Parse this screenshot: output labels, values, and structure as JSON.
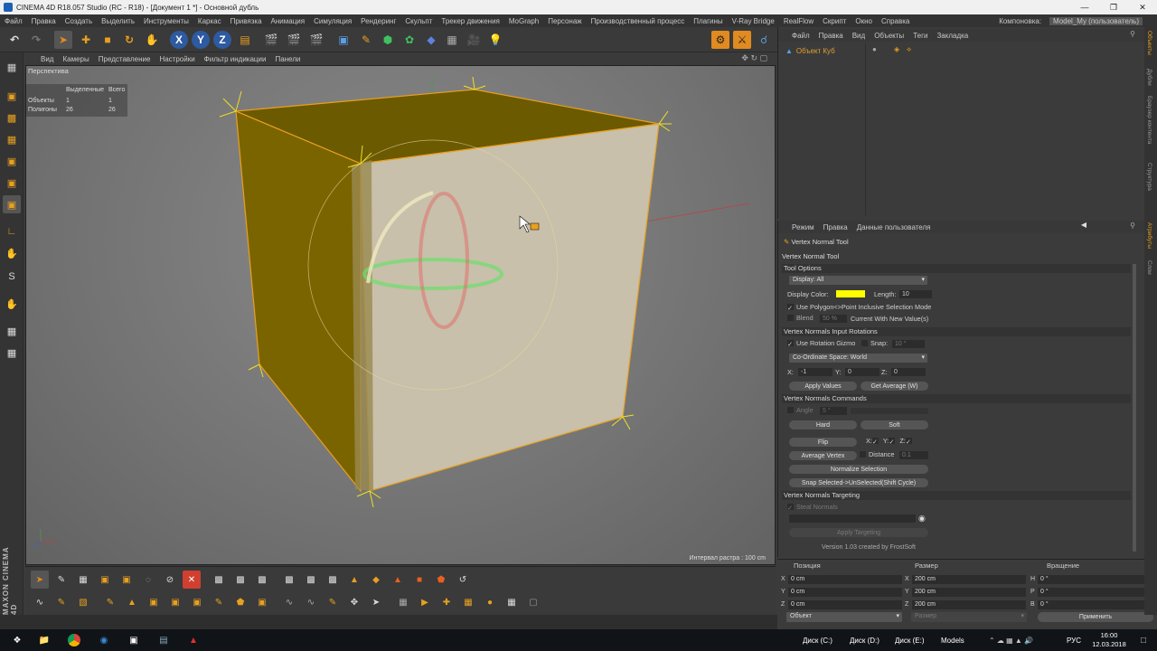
{
  "window": {
    "title": "CINEMA 4D R18.057 Studio (RC - R18) - [Документ 1 *] - Основной дубль"
  },
  "menu": [
    "Файл",
    "Правка",
    "Создать",
    "Выделить",
    "Инструменты",
    "Каркас",
    "Привязка",
    "Анимация",
    "Симуляция",
    "Рендеринг",
    "Скульпт",
    "Трекер движения",
    "MoGraph",
    "Персонаж",
    "Производственный процесс",
    "Плагины",
    "V-Ray Bridge",
    "RealFlow",
    "Скрипт",
    "Окно",
    "Справка"
  ],
  "layout": {
    "label": "Компоновка:",
    "value": "Model_My (пользователь)"
  },
  "viewport": {
    "menu": [
      "Вид",
      "Камеры",
      "Представление",
      "Настройки",
      "Фильтр индикации",
      "Панели"
    ],
    "label": "Перспектива",
    "hud": {
      "col_selected": "Выделенные",
      "col_total": "Всего",
      "row_objects": "Объекты",
      "row_polygons": "Полигоны",
      "objects_selected": "1",
      "objects_total": "1",
      "polygons_selected": "26",
      "polygons_total": "26"
    },
    "grid_note": "Интервал растра : 100 cm"
  },
  "object_manager": {
    "menu": [
      "Файл",
      "Правка",
      "Вид",
      "Объекты",
      "Теги",
      "Закладка"
    ],
    "object_name": "Объект Куб"
  },
  "attributes": {
    "menu": [
      "Режим",
      "Правка",
      "Данные пользователя"
    ],
    "header_title": "Vertex Normal Tool",
    "title": "Vertex Normal Tool",
    "tool_options": "Tool Options",
    "display_label": "Display: All",
    "display_color_label": "Display Color:",
    "display_color": "#ffff00",
    "length_label": "Length:",
    "length_value": "10",
    "use_polygon_point": "Use Polygon<>Point Inclusive Selection Mode",
    "blend_label": "Blend",
    "blend_value": "50 %",
    "current_with_new": "Current With New Value(s)",
    "input_rotations": "Vertex Normals Input Rotations",
    "use_rotation_gizmo": "Use Rotation Gizmo",
    "snap_label": "Snap:",
    "snap_value": "10 °",
    "coord_space": "Co-Ordinate Space: World",
    "x_label": "X:",
    "x_value": "-1",
    "y_label": "Y:",
    "y_value": "0",
    "z_label": "Z:",
    "z_value": "0",
    "apply_values": "Apply Values",
    "get_average": "Get Average (W)",
    "commands": "Vertex Normals Commands",
    "angle_label": "Angle",
    "angle_value": "5 °",
    "hard": "Hard",
    "soft": "Soft",
    "flip": "Flip",
    "flip_x": "X:",
    "flip_y": "Y:",
    "flip_z": "Z:",
    "average_vertex": "Average Vertex",
    "distance_label": "Distance",
    "distance_value": "0.1",
    "normalize_selection": "Normalize Selection",
    "snap_selected": "Snap Selected->UnSelected(Shift Cycle)",
    "targeting": "Vertex Normals Targeting",
    "steal_normals": "Steal Normals",
    "apply_targeting": "Apply Targeting",
    "version": "Version 1.03 created by FrostSoft"
  },
  "coords": {
    "position": "Позиция",
    "size": "Размер",
    "rotation": "Вращение",
    "px": "0 cm",
    "py": "0 cm",
    "pz": "0 cm",
    "sx": "200 cm",
    "sy": "200 cm",
    "sz": "200 cm",
    "rh": "0 °",
    "rp": "0 °",
    "rb": "0 °",
    "mode": "Объект",
    "size_mode": "Размер",
    "apply": "Применить",
    "lx": "X",
    "ly": "Y",
    "lz": "Z",
    "lsx": "X",
    "lsy": "Y",
    "lsz": "Z",
    "lh": "H",
    "lp": "P",
    "lb": "B"
  },
  "right_strip": [
    "Объекты",
    "Дубли",
    "Браузер контента",
    "Структура"
  ],
  "right_strip2": [
    "Атрибуты",
    "Слои"
  ],
  "taskbar": {
    "disk_c": "Диск (C:)",
    "disk_d": "Диск (D:)",
    "disk_e": "Диск (E:)",
    "models": "Models",
    "lang": "РУС",
    "time": "16:00",
    "date": "12.03.2018"
  },
  "brand": "MAXON CINEMA 4D"
}
